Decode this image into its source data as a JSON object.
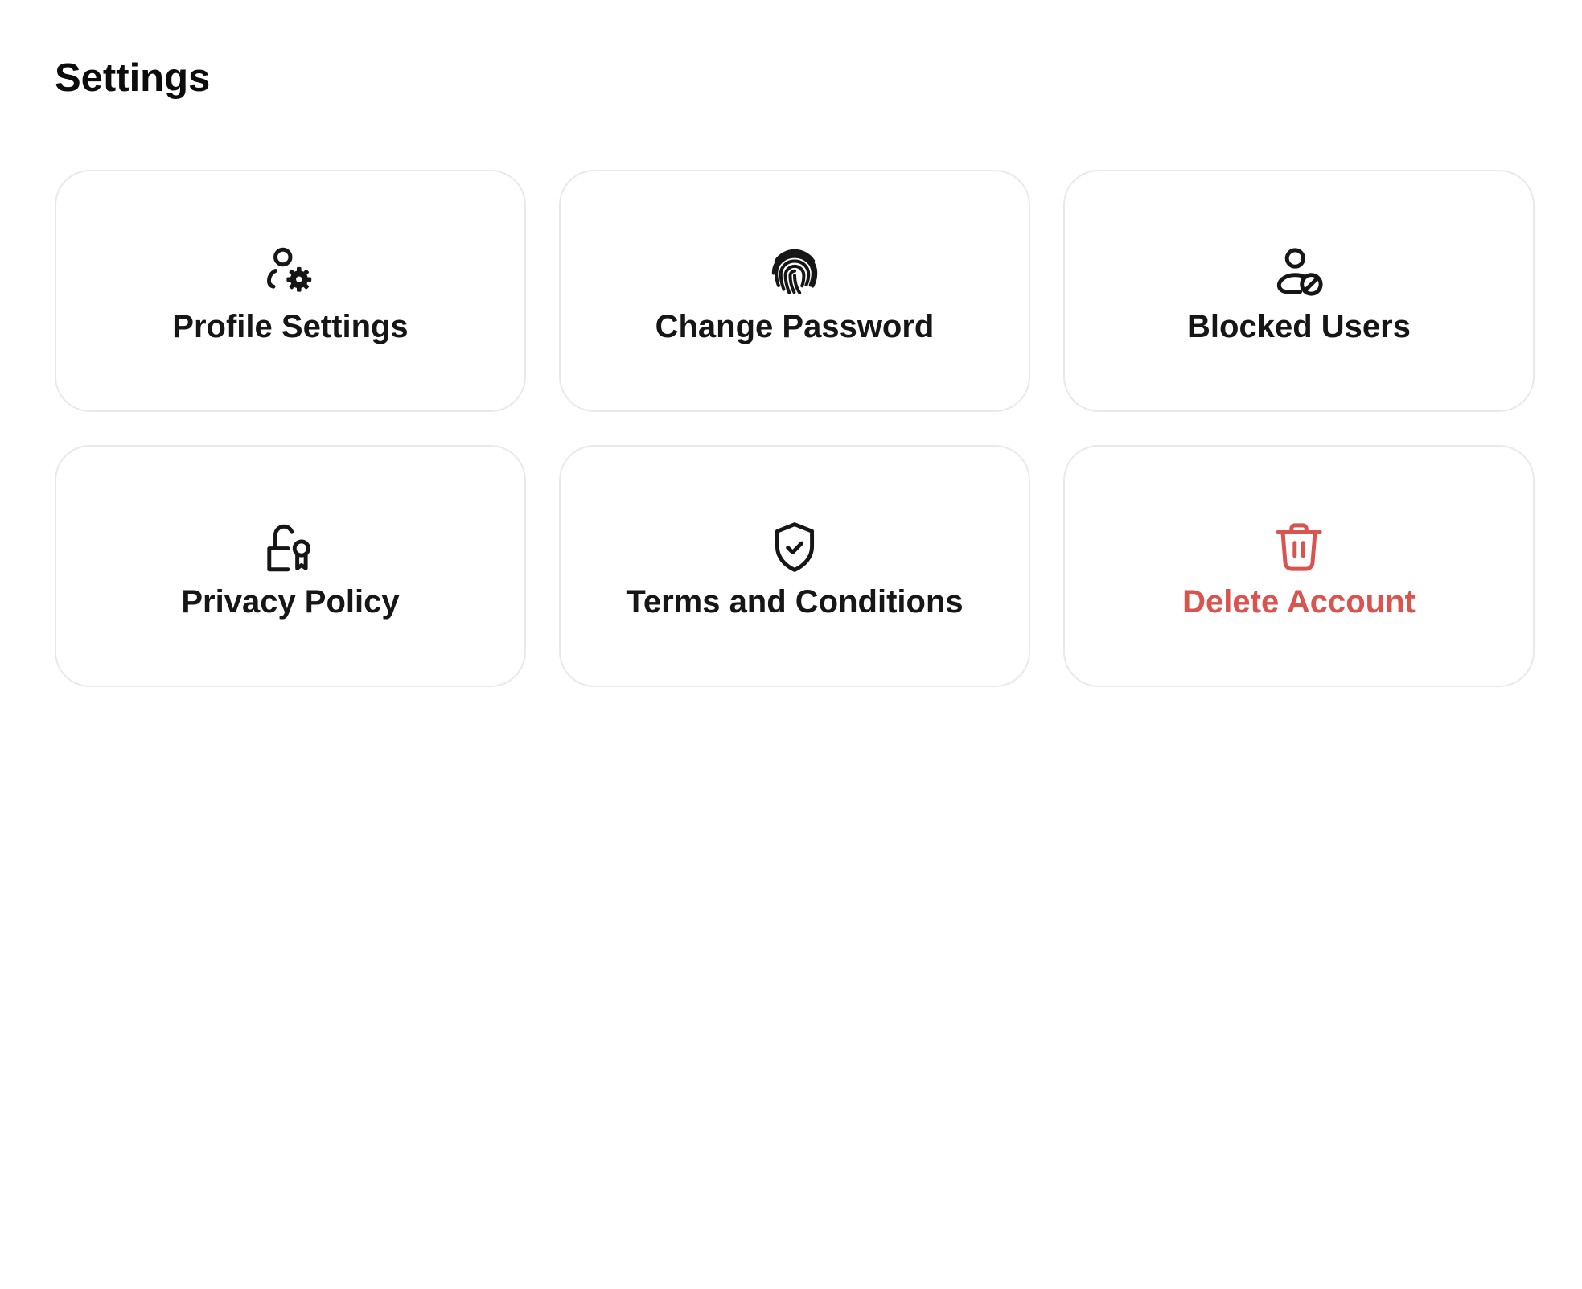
{
  "page": {
    "title": "Settings"
  },
  "cards": [
    {
      "label": "Profile Settings",
      "icon": "user-gear-icon"
    },
    {
      "label": "Change Password",
      "icon": "fingerprint-icon"
    },
    {
      "label": "Blocked Users",
      "icon": "user-block-icon"
    },
    {
      "label": "Privacy Policy",
      "icon": "unlock-award-icon"
    },
    {
      "label": "Terms and Conditions",
      "icon": "shield-check-icon"
    },
    {
      "label": "Delete Account",
      "icon": "trash-icon"
    }
  ],
  "colors": {
    "text": "#161616",
    "danger": "#d9534f",
    "card_border": "#e9e9e9",
    "background": "#ffffff"
  }
}
